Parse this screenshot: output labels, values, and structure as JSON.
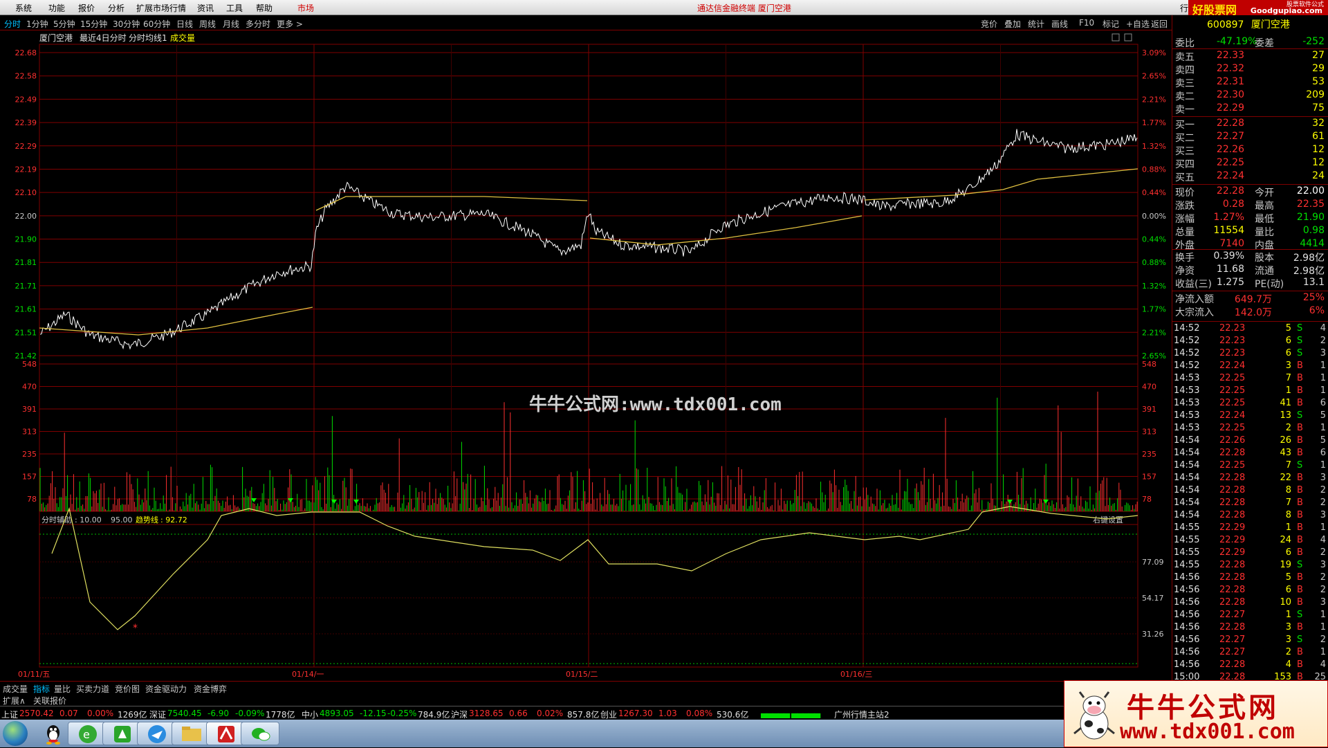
{
  "menu": {
    "items": [
      "系统",
      "功能",
      "报价",
      "分析",
      "扩展市场行情",
      "资讯",
      "工具",
      "帮助"
    ],
    "market": "市场",
    "app_title": "通达信金融终端  厦门空港",
    "brand_top": "好股票网",
    "brand_top_url": "Goodgupiao.com",
    "brand_top_small": "股票软件公式",
    "brand_left": "行"
  },
  "tabs": {
    "periods": [
      "分时",
      "1分钟",
      "5分钟",
      "15分钟",
      "30分钟",
      "60分钟",
      "日线",
      "周线",
      "月线",
      "多分时",
      "更多 >"
    ],
    "tools": [
      "竞价",
      "叠加",
      "统计",
      "画线",
      "F10",
      "标记",
      "+自选",
      "返回"
    ]
  },
  "chart_header": {
    "name": "厦门空港",
    "desc": "最近4日分时",
    "avg_label": "分时均线1",
    "vol_label": "成交量"
  },
  "price_axis": [
    "22.68",
    "22.58",
    "22.49",
    "22.39",
    "22.29",
    "22.19",
    "22.10",
    "22.00",
    "21.90",
    "21.81",
    "21.71",
    "21.61",
    "21.51",
    "21.42"
  ],
  "pct_axis": [
    "3.09%",
    "2.65%",
    "2.21%",
    "1.77%",
    "1.32%",
    "0.88%",
    "0.44%",
    "0.00%",
    "0.44%",
    "0.88%",
    "1.32%",
    "1.77%",
    "2.21%",
    "2.65%"
  ],
  "vol_axis": [
    "548",
    "470",
    "391",
    "313",
    "235",
    "157",
    "78"
  ],
  "indicator": {
    "label": "分时辅助",
    "v1": ": 10.00",
    "v2": "95.00",
    "trend_label": "趋势线",
    "trend_value": ": 92.72",
    "axis": [
      "77.09",
      "54.17",
      "31.26"
    ],
    "setting": "右键设置"
  },
  "date_axis": [
    "01/11/五",
    "01/14/一",
    "01/15/二",
    "01/16/三"
  ],
  "watermark": "牛牛公式网:www.tdx001.com",
  "quote": {
    "code": "600897",
    "name": "厦门空港",
    "weibi_label": "委比",
    "weibi": "-47.19%",
    "weicha_label": "委差",
    "weicha": "-252",
    "asks": [
      {
        "label": "卖五",
        "price": "22.33",
        "vol": "27"
      },
      {
        "label": "卖四",
        "price": "22.32",
        "vol": "29"
      },
      {
        "label": "卖三",
        "price": "22.31",
        "vol": "53"
      },
      {
        "label": "卖二",
        "price": "22.30",
        "vol": "209"
      },
      {
        "label": "卖一",
        "price": "22.29",
        "vol": "75"
      }
    ],
    "bids": [
      {
        "label": "买一",
        "price": "22.28",
        "vol": "32"
      },
      {
        "label": "买二",
        "price": "22.27",
        "vol": "61"
      },
      {
        "label": "买三",
        "price": "22.26",
        "vol": "12"
      },
      {
        "label": "买四",
        "price": "22.25",
        "vol": "12"
      },
      {
        "label": "买五",
        "price": "22.24",
        "vol": "24"
      }
    ],
    "stats": [
      {
        "l1": "现价",
        "v1": "22.28",
        "l2": "今开",
        "v2": "22.00",
        "c1": "#ff3030",
        "c2": "#ffffff"
      },
      {
        "l1": "涨跌",
        "v1": "0.28",
        "l2": "最高",
        "v2": "22.35",
        "c1": "#ff3030",
        "c2": "#ff3030"
      },
      {
        "l1": "涨幅",
        "v1": "1.27%",
        "l2": "最低",
        "v2": "21.90",
        "c1": "#ff3030",
        "c2": "#00e000"
      },
      {
        "l1": "总量",
        "v1": "11554",
        "l2": "量比",
        "v2": "0.98",
        "c1": "#ffff00",
        "c2": "#00e000"
      },
      {
        "l1": "外盘",
        "v1": "7140",
        "l2": "内盘",
        "v2": "4414",
        "c1": "#ff3030",
        "c2": "#00e000"
      }
    ],
    "stats2": [
      {
        "l1": "换手",
        "v1": "0.39%",
        "l2": "股本",
        "v2": "2.98亿"
      },
      {
        "l1": "净资",
        "v1": "11.68",
        "l2": "流通",
        "v2": "2.98亿"
      },
      {
        "l1": "收益(三)",
        "v1": "1.275",
        "l2": "PE(动)",
        "v2": "13.1"
      }
    ],
    "flow": [
      {
        "label": "净流入额",
        "value": "649.7万",
        "pct": "25%"
      },
      {
        "label": "大宗流入",
        "value": "142.0万",
        "pct": "6%"
      }
    ]
  },
  "trades": [
    {
      "t": "14:52",
      "p": "22.23",
      "v": "5",
      "d": "S",
      "n": "4"
    },
    {
      "t": "14:52",
      "p": "22.23",
      "v": "6",
      "d": "S",
      "n": "2"
    },
    {
      "t": "14:52",
      "p": "22.23",
      "v": "6",
      "d": "S",
      "n": "3"
    },
    {
      "t": "14:52",
      "p": "22.24",
      "v": "3",
      "d": "B",
      "n": "1"
    },
    {
      "t": "14:53",
      "p": "22.25",
      "v": "7",
      "d": "B",
      "n": "1"
    },
    {
      "t": "14:53",
      "p": "22.25",
      "v": "1",
      "d": "B",
      "n": "1"
    },
    {
      "t": "14:53",
      "p": "22.25",
      "v": "41",
      "d": "B",
      "n": "6"
    },
    {
      "t": "14:53",
      "p": "22.24",
      "v": "13",
      "d": "S",
      "n": "5"
    },
    {
      "t": "14:53",
      "p": "22.25",
      "v": "2",
      "d": "B",
      "n": "1"
    },
    {
      "t": "14:54",
      "p": "22.26",
      "v": "26",
      "d": "B",
      "n": "5"
    },
    {
      "t": "14:54",
      "p": "22.28",
      "v": "43",
      "d": "B",
      "n": "6"
    },
    {
      "t": "14:54",
      "p": "22.25",
      "v": "7",
      "d": "S",
      "n": "1"
    },
    {
      "t": "14:54",
      "p": "22.28",
      "v": "22",
      "d": "B",
      "n": "3"
    },
    {
      "t": "14:54",
      "p": "22.28",
      "v": "8",
      "d": "B",
      "n": "2"
    },
    {
      "t": "14:54",
      "p": "22.28",
      "v": "7",
      "d": "B",
      "n": "2"
    },
    {
      "t": "14:54",
      "p": "22.28",
      "v": "8",
      "d": "B",
      "n": "3"
    },
    {
      "t": "14:55",
      "p": "22.29",
      "v": "1",
      "d": "B",
      "n": "1"
    },
    {
      "t": "14:55",
      "p": "22.29",
      "v": "24",
      "d": "B",
      "n": "4"
    },
    {
      "t": "14:55",
      "p": "22.29",
      "v": "6",
      "d": "B",
      "n": "2"
    },
    {
      "t": "14:55",
      "p": "22.28",
      "v": "19",
      "d": "S",
      "n": "3"
    },
    {
      "t": "14:56",
      "p": "22.28",
      "v": "5",
      "d": "B",
      "n": "2"
    },
    {
      "t": "14:56",
      "p": "22.28",
      "v": "6",
      "d": "B",
      "n": "2"
    },
    {
      "t": "14:56",
      "p": "22.28",
      "v": "10",
      "d": "B",
      "n": "3"
    },
    {
      "t": "14:56",
      "p": "22.27",
      "v": "1",
      "d": "S",
      "n": "1"
    },
    {
      "t": "14:56",
      "p": "22.28",
      "v": "3",
      "d": "B",
      "n": "1"
    },
    {
      "t": "14:56",
      "p": "22.27",
      "v": "3",
      "d": "S",
      "n": "2"
    },
    {
      "t": "14:56",
      "p": "22.27",
      "v": "2",
      "d": "B",
      "n": "1"
    },
    {
      "t": "14:56",
      "p": "22.28",
      "v": "4",
      "d": "B",
      "n": "4"
    },
    {
      "t": "15:00",
      "p": "22.28",
      "v": "153",
      "d": "B",
      "n": "25"
    }
  ],
  "bottom_tabs": [
    "成交量",
    "指标",
    "量比",
    "买卖力道",
    "竞价图",
    "资金驱动力",
    "资金博弈"
  ],
  "ext_tabs": [
    "扩展∧",
    "关联报价"
  ],
  "status": [
    {
      "name": "上证",
      "val": "2570.42",
      "chg": "0.07",
      "pct": "0.00%",
      "amt": "1269亿"
    },
    {
      "name": "深证",
      "val": "7540.45",
      "chg": "-6.90",
      "pct": "-0.09%",
      "amt": "1778亿"
    },
    {
      "name": "中小",
      "val": "4893.05",
      "chg": "-12.15",
      "pct": "-0.25%",
      "amt": "784.9亿"
    },
    {
      "name": "沪深",
      "val": "3128.65",
      "chg": "0.66",
      "pct": "0.02%",
      "amt": "857.8亿"
    },
    {
      "name": "创业",
      "val": "1267.30",
      "chg": "1.03",
      "pct": "0.08%",
      "amt": "530.6亿"
    }
  ],
  "server": "广州行情主站2",
  "logo": {
    "cn": "牛牛公式网",
    "url": "www.tdx001.com"
  },
  "colors": {
    "up": "#ff3030",
    "down": "#00e000",
    "grid": "#800000",
    "price_line": "#ffffff",
    "avg_line": "#ffff00",
    "accent": "#ffff00"
  }
}
